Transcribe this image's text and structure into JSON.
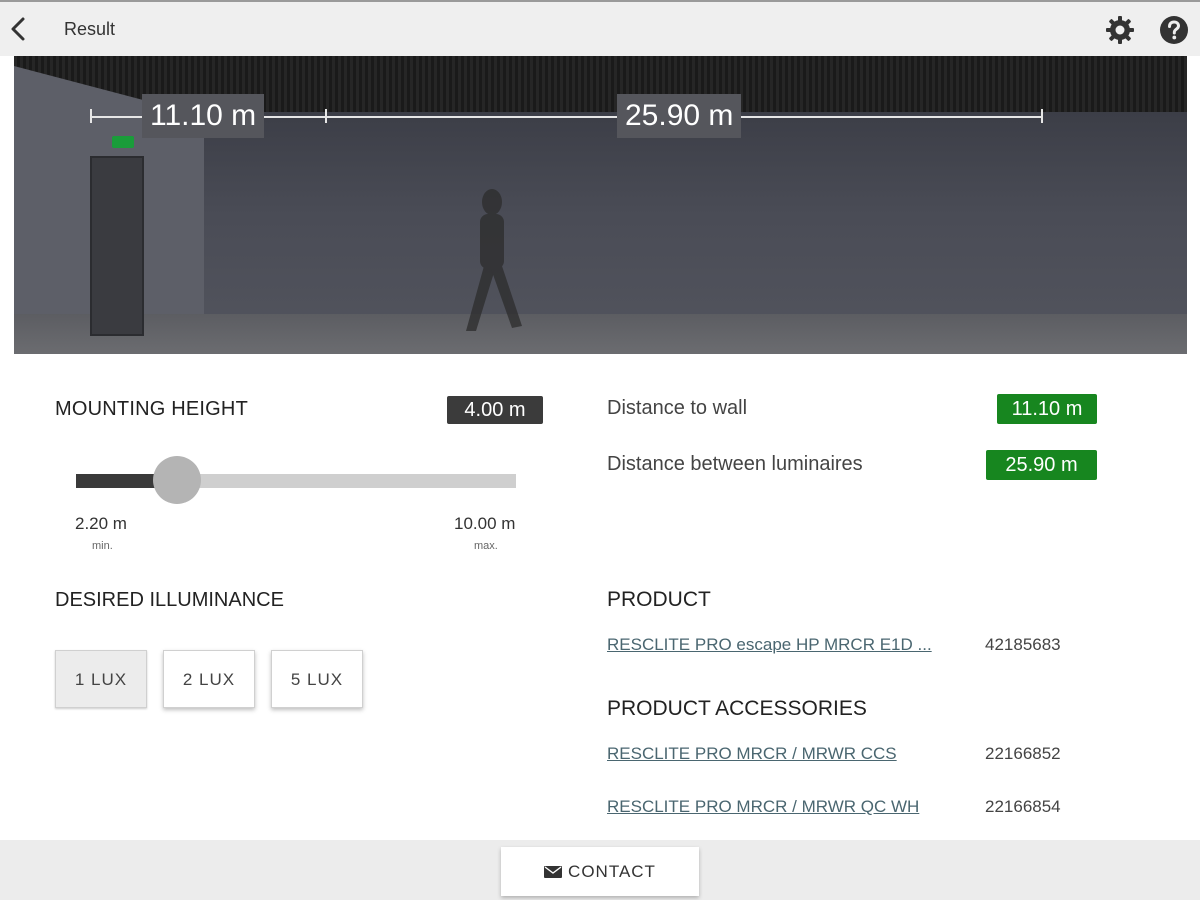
{
  "header": {
    "title": "Result",
    "back_icon": "chevron-left-icon",
    "settings_icon": "gear-icon",
    "help_icon": "help-icon"
  },
  "scene": {
    "dim_wall": "11.10 m",
    "dim_between": "25.90 m"
  },
  "mounting_height": {
    "title": "MOUNTING HEIGHT",
    "value": "4.00 m",
    "min_value": "2.20 m",
    "min_caption": "min.",
    "max_value": "10.00 m",
    "max_caption": "max.",
    "slider_fraction": 0.23
  },
  "illuminance": {
    "title": "DESIRED ILLUMINANCE",
    "options": [
      "1 LUX",
      "2 LUX",
      "5 LUX"
    ],
    "selected": "1 LUX"
  },
  "distances": {
    "wall_label": "Distance to wall",
    "wall_value": "11.10 m",
    "between_label": "Distance between luminaires",
    "between_value": "25.90 m"
  },
  "product": {
    "title": "PRODUCT",
    "items": [
      {
        "name": "RESCLITE PRO escape HP MRCR E1D ...",
        "number": "42185683"
      }
    ]
  },
  "accessories": {
    "title": "PRODUCT ACCESSORIES",
    "items": [
      {
        "name": "RESCLITE PRO MRCR / MRWR CCS",
        "number": "22166852"
      },
      {
        "name": "RESCLITE PRO MRCR / MRWR QC WH",
        "number": "22166854"
      }
    ]
  },
  "footer": {
    "contact_label": "CONTACT",
    "contact_icon": "mail-icon"
  },
  "colors": {
    "badge_green": "#17861f",
    "badge_dark": "#3b3b3b"
  }
}
